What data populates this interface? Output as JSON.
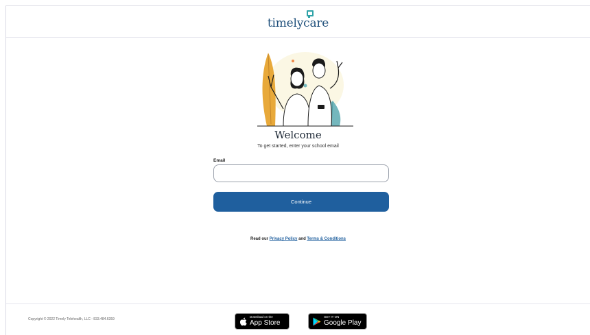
{
  "header": {
    "logo_part1": "timely",
    "logo_part2": "care"
  },
  "main": {
    "title": "Welcome",
    "subtitle": "To get started, enter your school email",
    "email_label": "Email",
    "email_value": "",
    "continue_label": "Continue",
    "legal_prefix": "Read our",
    "privacy_label": "Privacy Policy",
    "legal_and": "and",
    "terms_label": "Terms & Conditions"
  },
  "footer": {
    "copyright": "Copyright © 2022 Timely Telehealth, LLC - 833.484.6359",
    "appstore_small": "Download on the",
    "appstore_big": "App Store",
    "googleplay_small": "GET IT ON",
    "googleplay_big": "Google Play"
  },
  "colors": {
    "brand_primary": "#1f5f9e",
    "brand_teal": "#2fa3a8",
    "logo_text": "#1e4f7b"
  },
  "icons": [
    "logo-mark-icon",
    "apple-icon",
    "google-play-icon"
  ]
}
